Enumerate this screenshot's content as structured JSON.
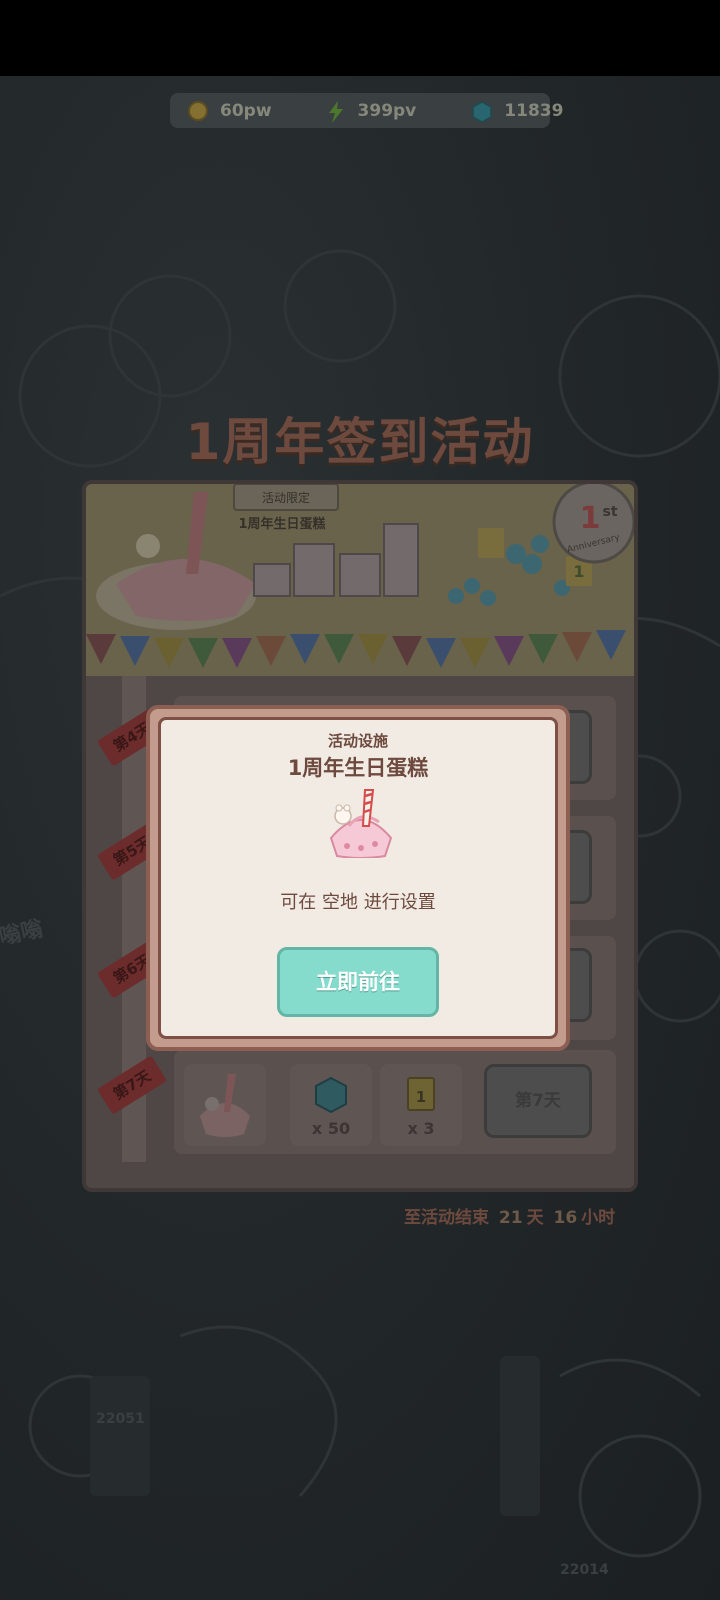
{
  "currencies": [
    {
      "icon": "coin-icon",
      "value": "60pw",
      "color": "#c9a33a"
    },
    {
      "icon": "lightning-icon",
      "value": "399pv",
      "color": "#7dbb3a"
    },
    {
      "icon": "gem-icon",
      "value": "11839",
      "color": "#2fa7b6"
    }
  ],
  "event": {
    "title": "1周年签到活动",
    "banner_tag": "活动限定",
    "banner_name": "1周年生日蛋糕",
    "anniversary_num": "1",
    "anniversary_sup": "st",
    "anniversary_text": "Anniversary",
    "ticket_num": "1",
    "cabin_sign": "1"
  },
  "days": [
    {
      "label": "第4天"
    },
    {
      "label": "第5天"
    },
    {
      "label": "第6天"
    },
    {
      "label": "第7天",
      "rewards": [
        {
          "icon": "cake-icon",
          "qty": ""
        },
        {
          "icon": "gem-icon",
          "qty": "x 50"
        },
        {
          "icon": "ticket-icon",
          "qty": "x 3",
          "num": "1"
        }
      ],
      "button": "第7天"
    }
  ],
  "countdown": {
    "prefix": "至活动结束",
    "days": "21",
    "days_unit": "天",
    "hours": "16",
    "hours_unit": "小时"
  },
  "dialog": {
    "subtitle": "活动设施",
    "title": "1周年生日蛋糕",
    "desc": "可在 空地 进行设置",
    "button": "立即前往"
  },
  "background": {
    "sign_left": "22051",
    "sign_right": "22014",
    "mood_text": "嗡嗡"
  },
  "colors": {
    "accent": "#86dccc",
    "dialog_bg": "#f1ebe4",
    "text_brown": "#6e4a3e"
  }
}
